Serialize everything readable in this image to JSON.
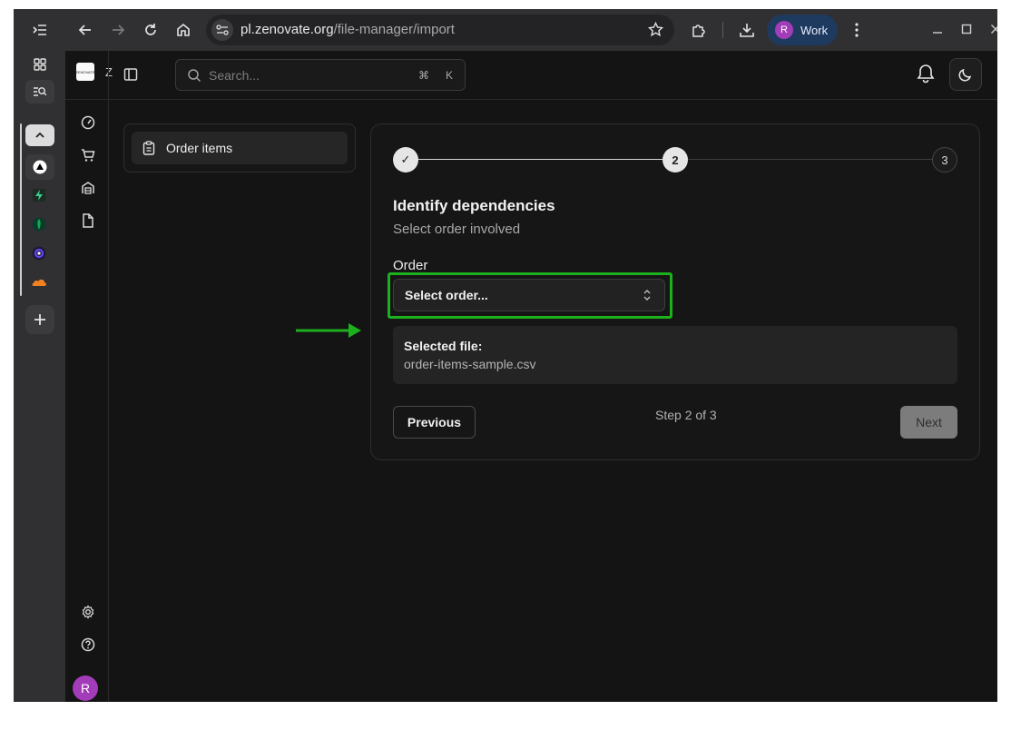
{
  "browser": {
    "url_host": "pl.zenovate.org",
    "url_path": "/file-manager/import",
    "profile_initial": "R",
    "profile_name": "Work"
  },
  "app": {
    "logo_text": "ZENOVATE",
    "logo_clip": "Z",
    "search": {
      "placeholder": "Search...",
      "shortcut_1": "⌘",
      "shortcut_2": "K"
    },
    "user_initial": "R"
  },
  "subnav": {
    "item_label": "Order items"
  },
  "wizard": {
    "steps": [
      "✓",
      "2",
      "3"
    ],
    "title": "Identify dependencies",
    "subtitle": "Select order involved",
    "order_label": "Order",
    "select_placeholder": "Select order...",
    "selected_file_label": "Selected file:",
    "selected_file_name": "order-items-sample.csv",
    "previous_label": "Previous",
    "step_text": "Step 2 of 3",
    "next_label": "Next"
  },
  "colors": {
    "highlight": "#1db01d",
    "avatar": "#a23cb8",
    "profile_chip": "#1f3a5f"
  }
}
